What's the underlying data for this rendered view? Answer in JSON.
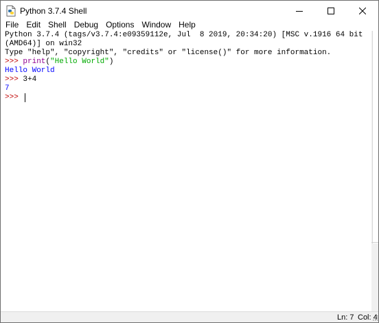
{
  "window": {
    "title": "Python 3.7.4 Shell"
  },
  "menu": [
    "File",
    "Edit",
    "Shell",
    "Debug",
    "Options",
    "Window",
    "Help"
  ],
  "shell": {
    "banner_line1": "Python 3.7.4 (tags/v3.7.4:e09359112e, Jul  8 2019, 20:34:20) [MSC v.1916 64 bit",
    "banner_line2": "(AMD64)] on win32",
    "banner_line3": "Type \"help\", \"copyright\", \"credits\" or \"license()\" for more information.",
    "prompt": ">>> ",
    "cmd1_func": "print",
    "cmd1_open": "(",
    "cmd1_string": "\"Hello World\"",
    "cmd1_close": ")",
    "output1": "Hello World",
    "cmd2": "3+4",
    "output2": "7"
  },
  "status": {
    "line": "Ln: 7",
    "col": "Col: 4"
  },
  "colors": {
    "prompt": "#c00000",
    "builtin": "#900090",
    "string": "#00aa00",
    "stdout": "#0000ff"
  },
  "icons": {
    "app": "python-idle-icon",
    "minimize": "minimize-icon",
    "maximize": "maximize-icon",
    "close": "close-icon"
  }
}
